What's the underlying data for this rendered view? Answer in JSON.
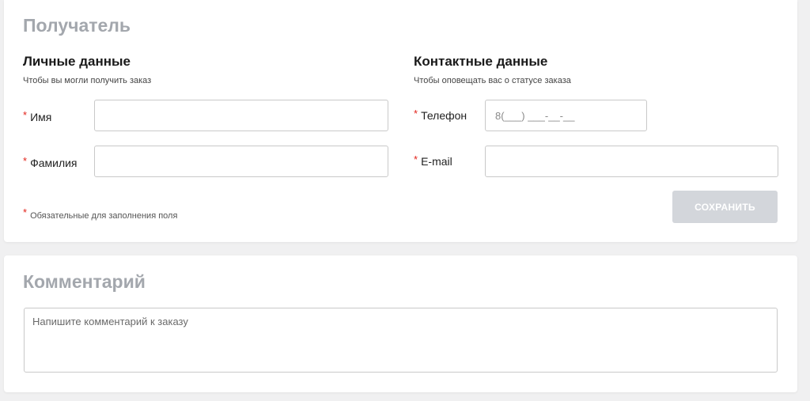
{
  "recipient": {
    "title": "Получатель",
    "personal": {
      "title": "Личные данные",
      "subtitle": "Чтобы вы могли получить заказ",
      "first_name_label": "Имя",
      "last_name_label": "Фамилия",
      "first_name_value": "",
      "last_name_value": ""
    },
    "contact": {
      "title": "Контактные данные",
      "subtitle": "Чтобы оповещать вас о статусе заказа",
      "phone_label": "Телефон",
      "phone_placeholder": "8(___) ___-__-__",
      "email_label": "E-mail",
      "email_value": ""
    },
    "required_marker": "*",
    "required_note": "Обязательные для заполнения поля",
    "save_label": "СОХРАНИТЬ"
  },
  "comment": {
    "title": "Комментарий",
    "placeholder": "Напишите комментарий к заказу"
  },
  "colors": {
    "required": "#e2231a",
    "section_title": "#a3a7ad",
    "button_disabled": "#d3d6db"
  }
}
